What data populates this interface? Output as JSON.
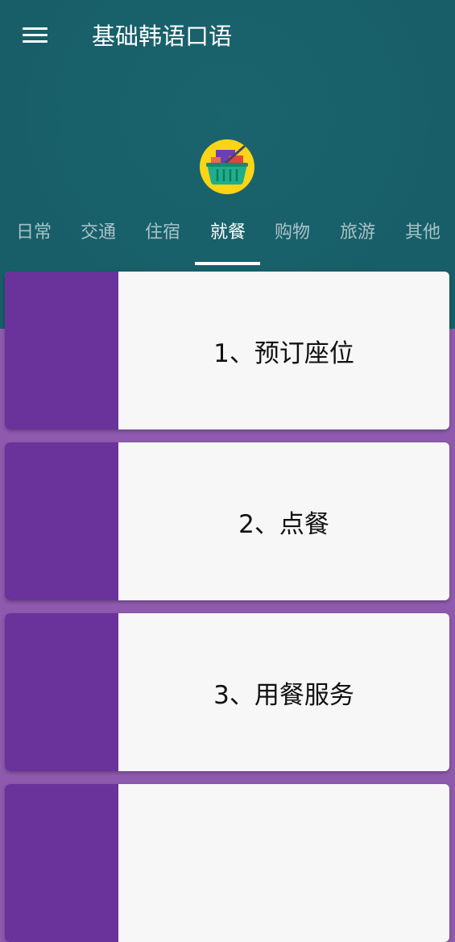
{
  "app_bar": {
    "title": "基础韩语口语",
    "menu_icon": "hamburger-menu-icon"
  },
  "header": {
    "category_icon": "shopping-basket-icon",
    "colors": {
      "background": "#175e68",
      "icon_circle": "#f9d515"
    }
  },
  "tabs": [
    {
      "label": "日常",
      "selected": false
    },
    {
      "label": "交通",
      "selected": false
    },
    {
      "label": "住宿",
      "selected": false
    },
    {
      "label": "就餐",
      "selected": true
    },
    {
      "label": "购物",
      "selected": false
    },
    {
      "label": "旅游",
      "selected": false
    },
    {
      "label": "其他",
      "selected": false
    }
  ],
  "lessons": [
    {
      "title": "1、预订座位"
    },
    {
      "title": "2、点餐"
    },
    {
      "title": "3、用餐服务"
    },
    {
      "title": ""
    }
  ],
  "colors": {
    "page_background": "#8f5aae",
    "card_stripe": "#6a329b",
    "card_background": "#f7f7f7"
  }
}
